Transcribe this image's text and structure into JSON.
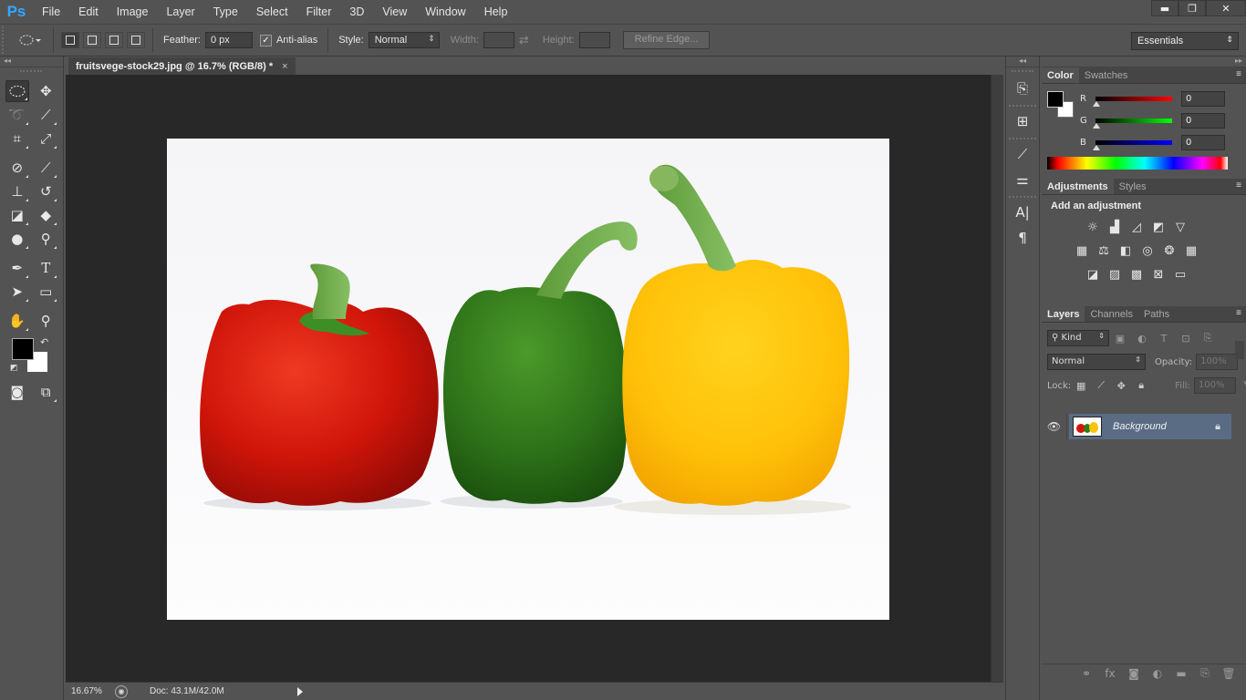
{
  "app": {
    "logo": "Ps"
  },
  "menu": [
    "File",
    "Edit",
    "Image",
    "Layer",
    "Type",
    "Select",
    "Filter",
    "3D",
    "View",
    "Window",
    "Help"
  ],
  "window_controls": {
    "minimize": "▬",
    "restore": "❐",
    "close": "✕"
  },
  "options_bar": {
    "feather_label": "Feather:",
    "feather_value": "0 px",
    "antialias_label": "Anti-alias",
    "antialias_checked": true,
    "style_label": "Style:",
    "style_value": "Normal",
    "width_label": "Width:",
    "height_label": "Height:",
    "refine_edge": "Refine Edge...",
    "workspace": "Essentials"
  },
  "document": {
    "tab_title": "fruitsvege-stock29.jpg @ 16.7% (RGB/8) *",
    "tab_close": "×",
    "zoom": "16.67%",
    "doc_size": "Doc: 43.1M/42.0M"
  },
  "color_panel": {
    "tabs": [
      "Color",
      "Swatches"
    ],
    "channels": [
      {
        "label": "R",
        "value": "0",
        "color": "#ff0000"
      },
      {
        "label": "G",
        "value": "0",
        "color": "#00ff00"
      },
      {
        "label": "B",
        "value": "0",
        "color": "#0000ff"
      }
    ],
    "foreground": "#000000",
    "background": "#ffffff"
  },
  "adjustments_panel": {
    "tabs": [
      "Adjustments",
      "Styles"
    ],
    "title": "Add an adjustment"
  },
  "layers_panel": {
    "tabs": [
      "Layers",
      "Channels",
      "Paths"
    ],
    "kind_label": "Kind",
    "blend_mode": "Normal",
    "opacity_label": "Opacity:",
    "opacity_value": "100%",
    "lock_label": "Lock:",
    "fill_label": "Fill:",
    "fill_value": "100%",
    "layers": [
      {
        "name": "Background",
        "visible": true,
        "locked": true
      }
    ]
  },
  "colors": {
    "accent": "#31a8ff",
    "selected_layer": "#5a6c84",
    "pepper_red": "#d8140a",
    "pepper_green": "#2e7d19",
    "pepper_yellow": "#ffc20a"
  }
}
